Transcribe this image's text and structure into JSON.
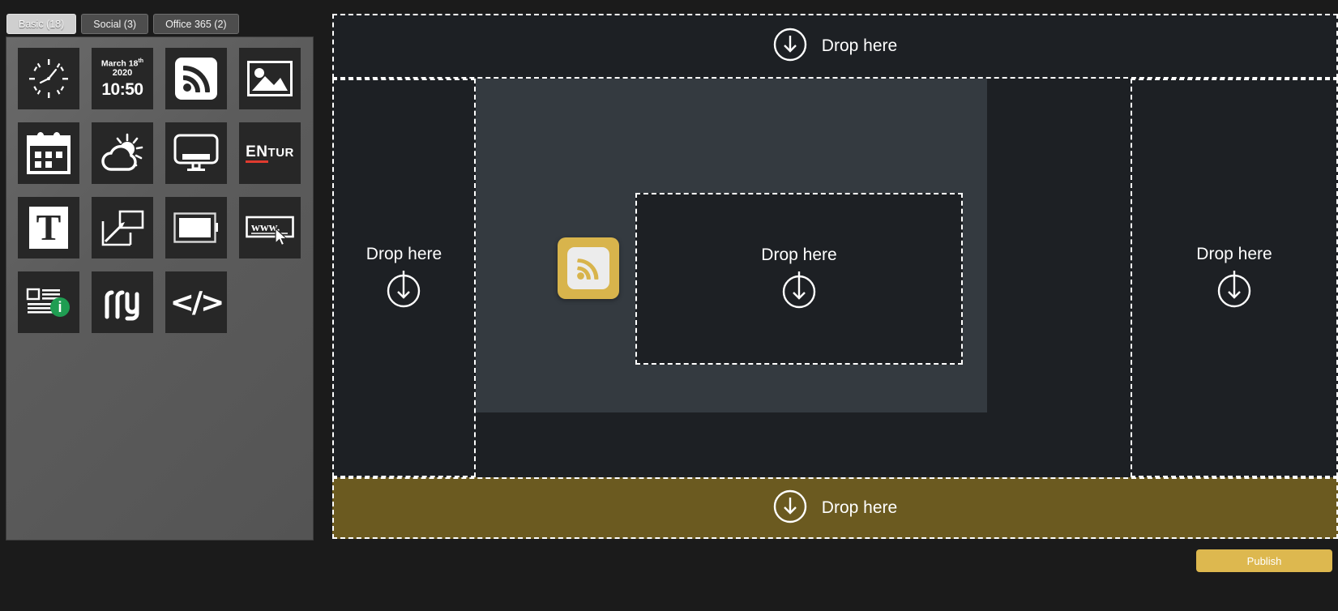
{
  "palette": {
    "tabs": [
      {
        "label": "Basic (18)",
        "active": true
      },
      {
        "label": "Social (3)",
        "active": false
      },
      {
        "label": "Office 365 (2)",
        "active": false
      }
    ],
    "widgets": [
      {
        "icon": "clock-icon",
        "name": "clock-widget"
      },
      {
        "icon": "date-time-icon",
        "name": "date-time-widget",
        "date": "March 18",
        "date_suffix": "th",
        "year": "2020",
        "time": "10:50"
      },
      {
        "icon": "rss-icon",
        "name": "rss-widget"
      },
      {
        "icon": "image-icon",
        "name": "image-widget"
      },
      {
        "icon": "calendar-icon",
        "name": "calendar-widget"
      },
      {
        "icon": "weather-icon",
        "name": "weather-widget"
      },
      {
        "icon": "monitor-icon",
        "name": "display-widget"
      },
      {
        "icon": "entur-logo-icon",
        "name": "entur-widget",
        "logo_primary": "EN",
        "logo_secondary": "TUR"
      },
      {
        "icon": "text-icon",
        "name": "text-widget",
        "glyph": "T"
      },
      {
        "icon": "scale-icon",
        "name": "scale-widget"
      },
      {
        "icon": "box-icon",
        "name": "box-widget"
      },
      {
        "icon": "web-icon",
        "name": "web-widget",
        "glyph": "www."
      },
      {
        "icon": "news-info-icon",
        "name": "news-widget"
      },
      {
        "icon": "ruter-logo-icon",
        "name": "ruter-widget",
        "glyph": "ry"
      },
      {
        "icon": "code-icon",
        "name": "code-widget",
        "glyph": "</>"
      }
    ]
  },
  "canvas": {
    "dropzones": [
      {
        "id": "top",
        "label": "Drop here",
        "layout": "icon-left",
        "highlighted": false
      },
      {
        "id": "left",
        "label": "Drop here",
        "layout": "text-above",
        "highlighted": false
      },
      {
        "id": "center",
        "label": "Drop here",
        "layout": "text-above",
        "highlighted": false
      },
      {
        "id": "right",
        "label": "Drop here",
        "layout": "text-above",
        "highlighted": false
      },
      {
        "id": "bottom",
        "label": "Drop here",
        "layout": "icon-left",
        "highlighted": true
      }
    ],
    "dragged_item": {
      "icon": "rss-icon",
      "label": "RSS"
    }
  },
  "footer": {
    "publish_label": "Publish"
  },
  "colors": {
    "accent_gold": "#ddb84f",
    "highlight_olive": "#6b5a20",
    "canvas_dark": "#1d2024",
    "canvas_mid": "#343a40",
    "tile_dark": "#272727",
    "entur_red": "#e03b2f",
    "news_green": "#1f9d52"
  }
}
